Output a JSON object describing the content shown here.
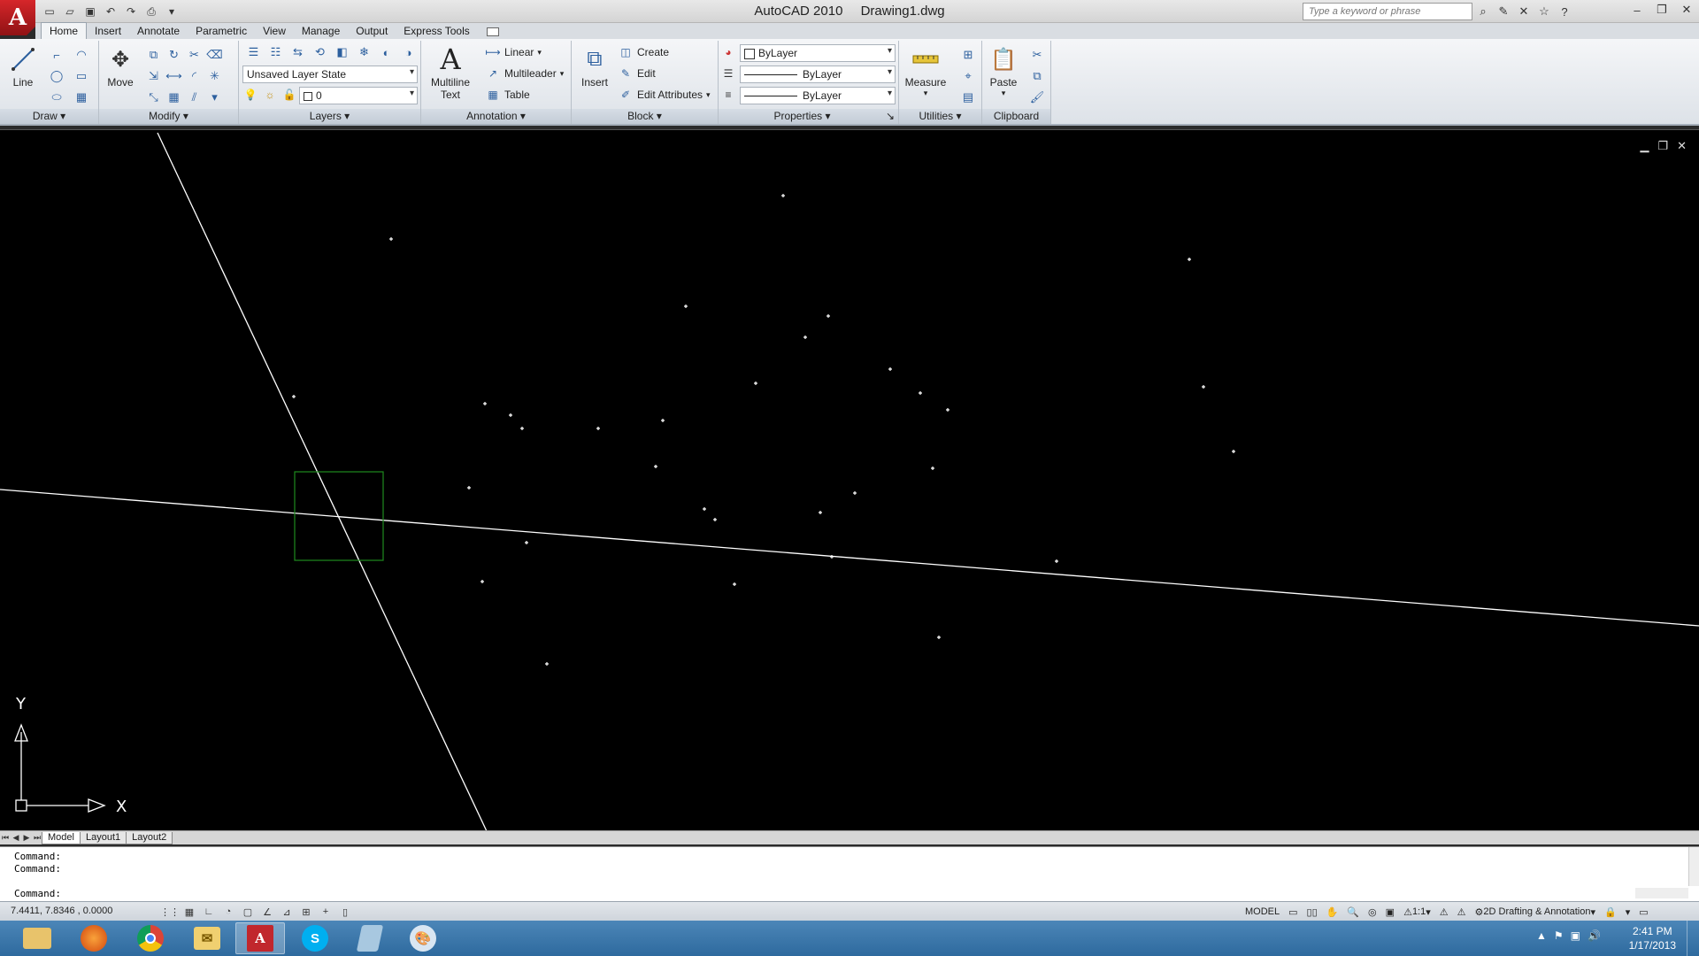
{
  "title": {
    "app": "AutoCAD 2010",
    "file": "Drawing1.dwg"
  },
  "search": {
    "placeholder": "Type a keyword or phrase"
  },
  "ribbon_tabs": [
    "Home",
    "Insert",
    "Annotate",
    "Parametric",
    "View",
    "Manage",
    "Output",
    "Express Tools"
  ],
  "panels": {
    "draw": {
      "title": "Draw",
      "line_label": "Line"
    },
    "modify": {
      "title": "Modify",
      "move_label": "Move"
    },
    "layers": {
      "title": "Layers",
      "layer_state": "Unsaved Layer State",
      "current_layer": "0"
    },
    "annotation": {
      "title": "Annotation",
      "mtext_label_1": "Multiline",
      "mtext_label_2": "Text",
      "linear": "Linear",
      "multileader": "Multileader",
      "table": "Table"
    },
    "block": {
      "title": "Block",
      "insert": "Insert",
      "create": "Create",
      "edit": "Edit",
      "edit_attributes": "Edit Attributes"
    },
    "properties": {
      "title": "Properties",
      "color": "ByLayer",
      "linetype": "ByLayer",
      "lineweight": "ByLayer"
    },
    "utilities": {
      "title": "Utilities",
      "measure": "Measure"
    },
    "clipboard": {
      "title": "Clipboard",
      "paste": "Paste"
    }
  },
  "drawing": {
    "background": "#000000",
    "line_color": "#ffffff",
    "box_color": "#1e8a1e",
    "ucs_y": "Y",
    "ucs_x": "X"
  },
  "layout_tabs": [
    "Model",
    "Layout1",
    "Layout2"
  ],
  "command": {
    "line1": "Command:",
    "line2": "Command:",
    "prompt": "Command:"
  },
  "status": {
    "coords": "7.4411, 7.8346 , 0.0000",
    "model": "MODEL",
    "scale": "1:1",
    "workspace": "2D Drafting & Annotation"
  },
  "clock": {
    "time": "2:41 PM",
    "date": "1/17/2013"
  }
}
